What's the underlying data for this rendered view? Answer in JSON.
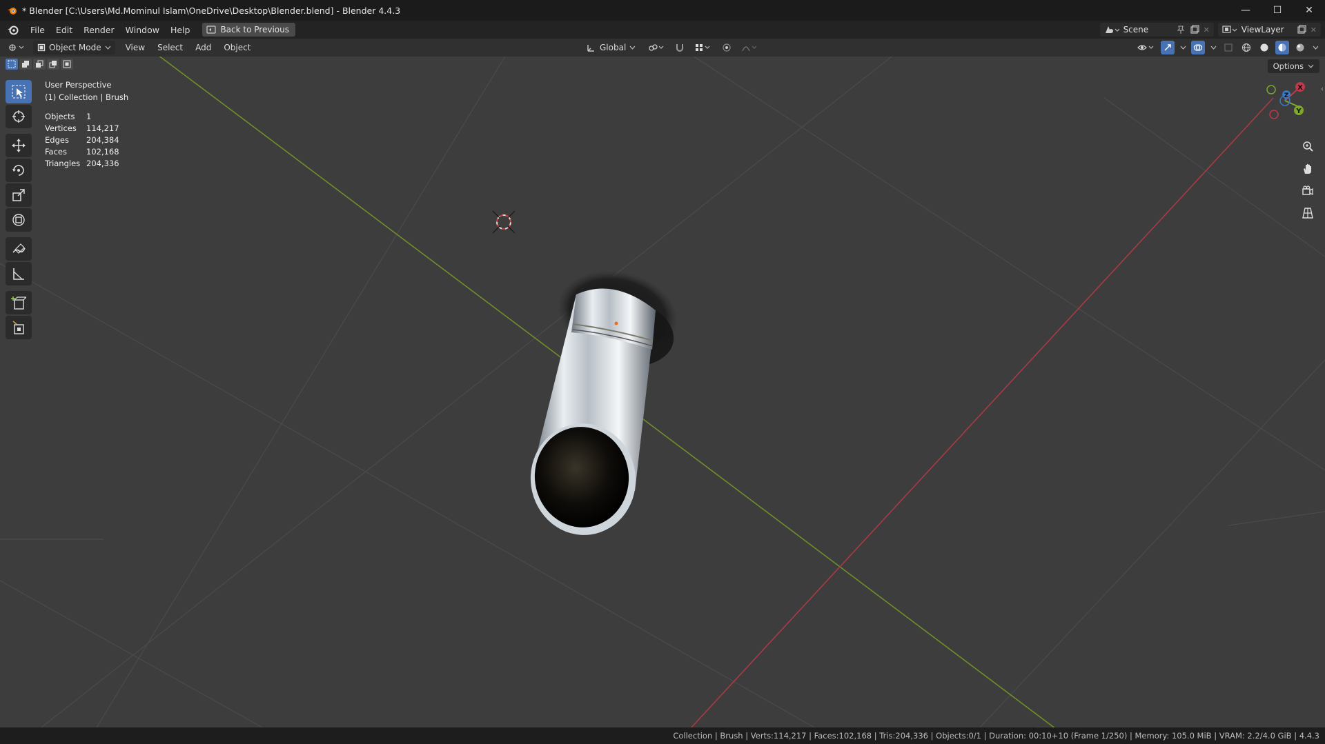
{
  "window": {
    "title": "* Blender [C:\\Users\\Md.Mominul Islam\\OneDrive\\Desktop\\Blender.blend] - Blender 4.4.3",
    "controls": {
      "minimize": "—",
      "maximize": "☐",
      "close": "✕"
    }
  },
  "menubar": {
    "items": [
      "File",
      "Edit",
      "Render",
      "Window",
      "Help"
    ],
    "back_button": "Back to Previous",
    "scene": "Scene",
    "view_layer": "ViewLayer"
  },
  "viewport_header": {
    "mode": "Object Mode",
    "menus": [
      "View",
      "Select",
      "Add",
      "Object"
    ],
    "orientation": "Global"
  },
  "viewport": {
    "perspective": "User Perspective",
    "collection": "(1) Collection | Brush",
    "stats": [
      {
        "label": "Objects",
        "value": "1"
      },
      {
        "label": "Vertices",
        "value": "114,217"
      },
      {
        "label": "Edges",
        "value": "204,384"
      },
      {
        "label": "Faces",
        "value": "102,168"
      },
      {
        "label": "Triangles",
        "value": "204,336"
      }
    ],
    "options_label": "Options",
    "gizmo_axes": {
      "x": "X",
      "y": "Y",
      "z": "Z"
    }
  },
  "statusbar": {
    "text": "Collection | Brush | Verts:114,217 | Faces:102,168 | Tris:204,336 | Objects:0/1 | Duration: 00:10+10 (Frame 1/250) | Memory: 105.0 MiB | VRAM: 2.2/4.0 GiB | 4.4.3"
  },
  "colors": {
    "accent": "#4772b3",
    "x_axis": "#c0394a",
    "y_axis": "#7fa82a",
    "z_axis": "#3b79c6"
  }
}
